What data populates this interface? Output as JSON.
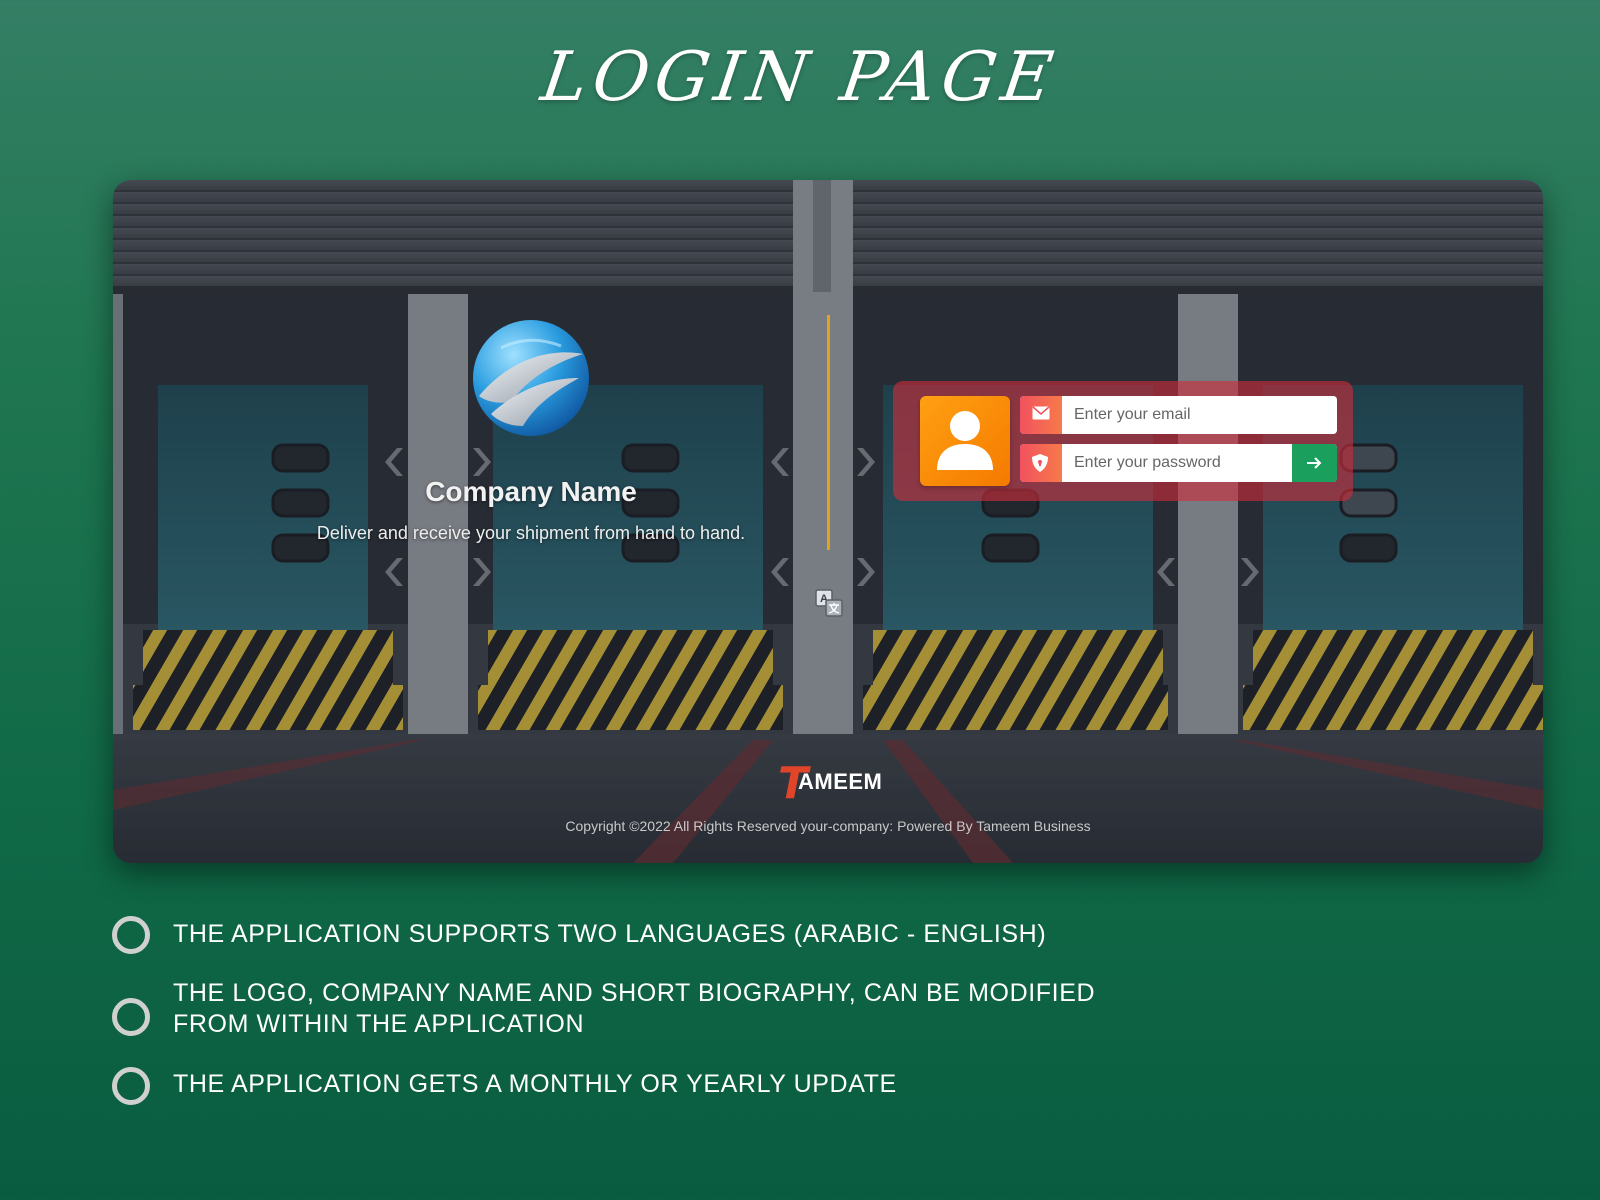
{
  "page": {
    "title": "LOGIN PAGE"
  },
  "login_screen": {
    "company_name": "Company Name",
    "tagline": "Deliver and receive your shipment from hand to hand.",
    "email_placeholder": "Enter your email",
    "password_placeholder": "Enter your password",
    "footer": {
      "logo_initial": "T",
      "logo_text": "AMEEM",
      "copyright": "Copyright ©2022 All Rights Reserved your-company: Powered By Tameem Business"
    }
  },
  "features": [
    {
      "text": "THE APPLICATION SUPPORTS TWO LANGUAGES (ARABIC - ENGLISH)"
    },
    {
      "text": "THE LOGO, COMPANY NAME AND SHORT BIOGRAPHY, CAN BE MODIFIED FROM WITHIN THE APPLICATION"
    },
    {
      "text": "THE APPLICATION GETS A MONTHLY OR YEARLY UPDATE"
    }
  ],
  "icons": {
    "avatar": "user-icon",
    "email": "envelope-icon",
    "password": "shield-icon",
    "submit": "arrow-right-icon",
    "language": "translate-icon",
    "brand": "globe-logo-icon"
  },
  "colors": {
    "page_background": "#1f7650",
    "login_box": "#cd2d3c",
    "avatar": "#f57a00",
    "field_icon": "#f2525f",
    "submit_button": "#1aa05c",
    "divider": "#e1a21c",
    "footer_logo_accent": "#e0452a"
  }
}
